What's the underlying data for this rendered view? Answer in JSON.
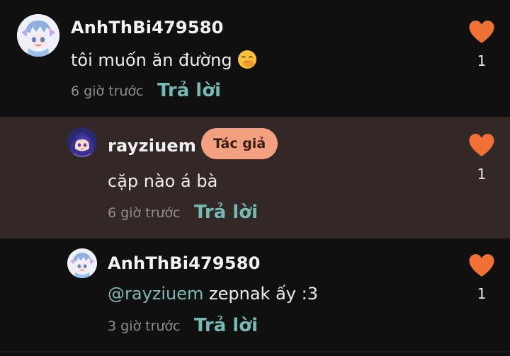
{
  "colors": {
    "heart": "#f07136",
    "reply_link": "#74b9b2",
    "mention": "#7fb9b3",
    "author_badge_bg": "#f2a07f",
    "highlight_row_bg": "#332826"
  },
  "comments": [
    {
      "username": "AnhThBi479580",
      "text": "tôi muốn ăn đường",
      "emoji": "hand-over-mouth-emoji",
      "time": "6 giờ trước",
      "reply_label": "Trả lời",
      "likes": "1",
      "avatar_icon": "chibi-avatar-icon"
    },
    {
      "username": "rayziuem",
      "badge": "Tác giả",
      "text": "cặp nào á bà",
      "time": "6 giờ trước",
      "reply_label": "Trả lời",
      "likes": "1",
      "avatar_icon": "anime-girl-avatar-icon"
    },
    {
      "username": "AnhThBi479580",
      "mention": "@rayziuem",
      "text": " zepnak ấy :3",
      "time": "3 giờ trước",
      "reply_label": "Trả lời",
      "likes": "1",
      "avatar_icon": "chibi-avatar-icon"
    }
  ]
}
